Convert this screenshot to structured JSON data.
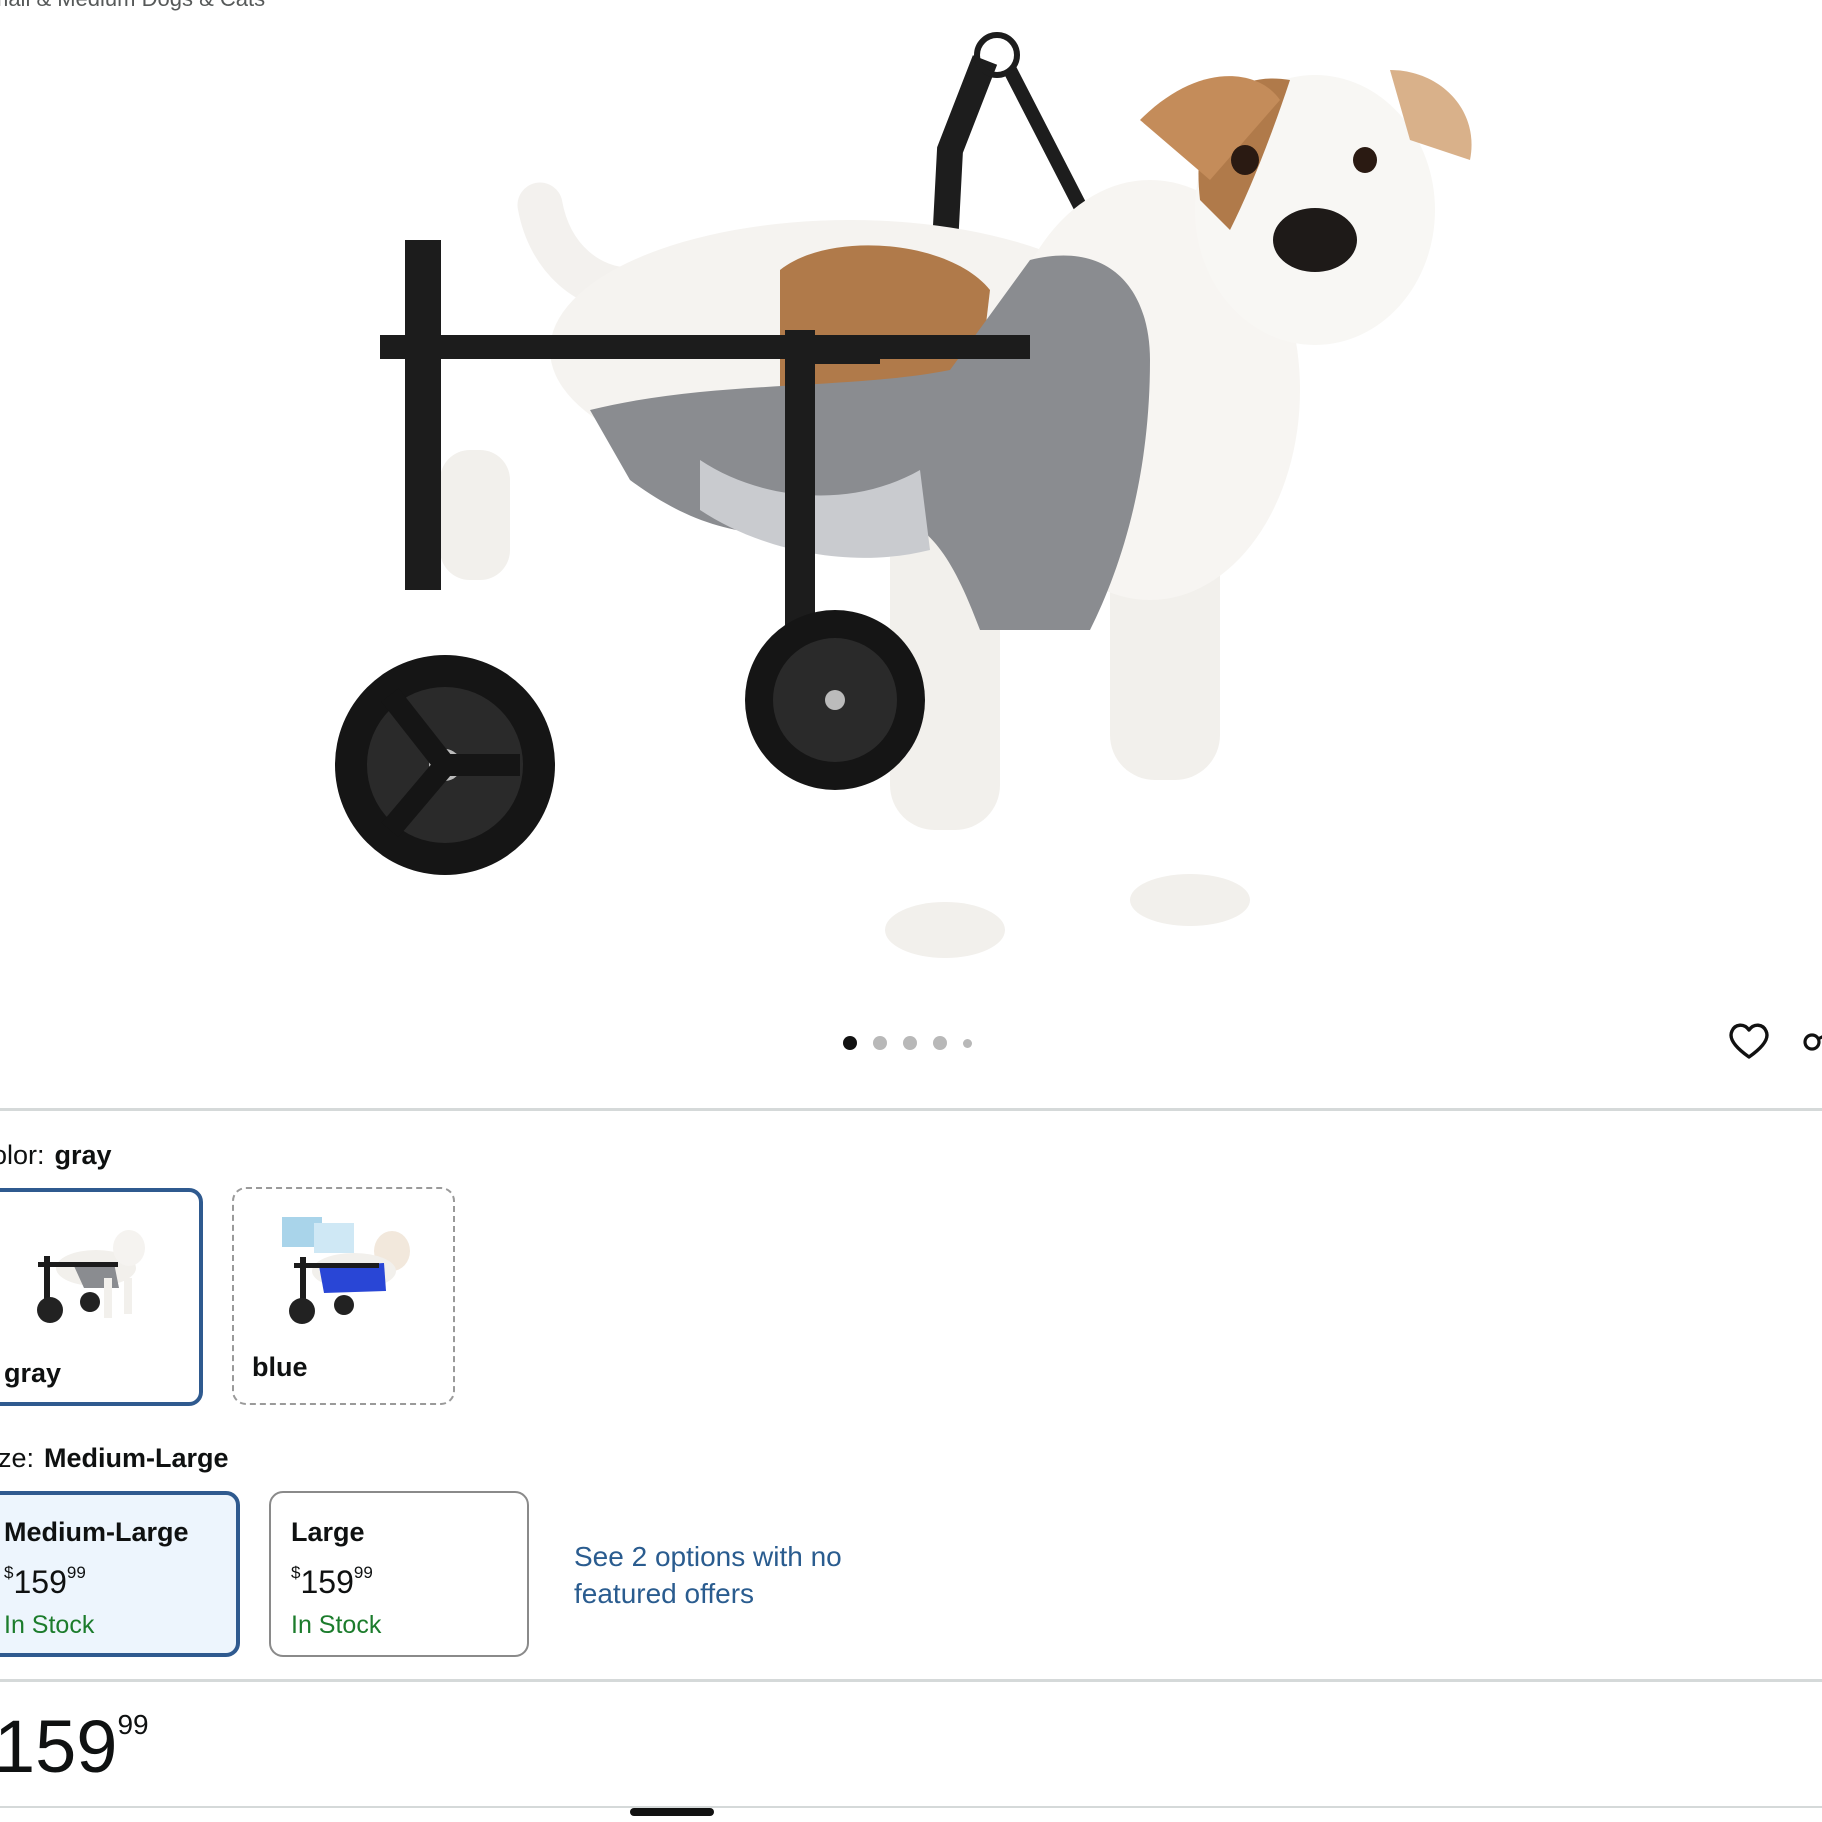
{
  "product": {
    "subtitle": "mall & Medium Dogs & Cats"
  },
  "gallery": {
    "image_icon": "dog-wheelchair-photo",
    "dot_count": 5,
    "active_dot": 0
  },
  "actions": {
    "favorite_icon": "heart-icon",
    "share_icon": "share-icon"
  },
  "color": {
    "label": "olor:",
    "selected": "gray",
    "options": [
      {
        "label": "gray",
        "selected": true
      },
      {
        "label": "blue",
        "selected": false
      }
    ]
  },
  "size": {
    "label": "ize:",
    "selected": "Medium-Large",
    "options": [
      {
        "name": "Medium-Large",
        "currency": "$",
        "price_whole": "159",
        "price_fraction": "99",
        "stock": "In Stock",
        "selected": true
      },
      {
        "name": "Large",
        "currency": "$",
        "price_whole": "159",
        "price_fraction": "99",
        "stock": "In Stock",
        "selected": false
      }
    ],
    "see_options": "See 2 options with no featured offers"
  },
  "price": {
    "whole": "159",
    "fraction": "99"
  },
  "colors": {
    "accent_border": "#2f5a8f",
    "stock_green": "#1c7c2c",
    "link_blue": "#2a5c8f",
    "selected_bg": "#edf5fd"
  }
}
